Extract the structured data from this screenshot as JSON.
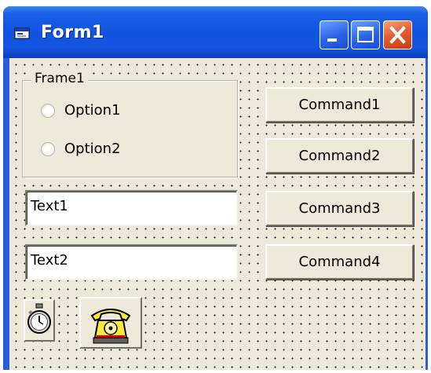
{
  "window": {
    "title": "Form1",
    "colors": {
      "titlebar": "#0f53df",
      "close": "#e35a2e",
      "client": "#ece9d8"
    }
  },
  "frame": {
    "label": "Frame1",
    "options": [
      {
        "label": "Option1",
        "selected": false
      },
      {
        "label": "Option2",
        "selected": false
      }
    ]
  },
  "textboxes": [
    {
      "value": "Text1"
    },
    {
      "value": "Text2"
    }
  ],
  "commands": [
    {
      "label": "Command1"
    },
    {
      "label": "Command2"
    },
    {
      "label": "Command3"
    },
    {
      "label": "Command4"
    }
  ],
  "controls": {
    "timer_icon": "stopwatch-icon",
    "telephone_icon": "telephone-icon"
  }
}
